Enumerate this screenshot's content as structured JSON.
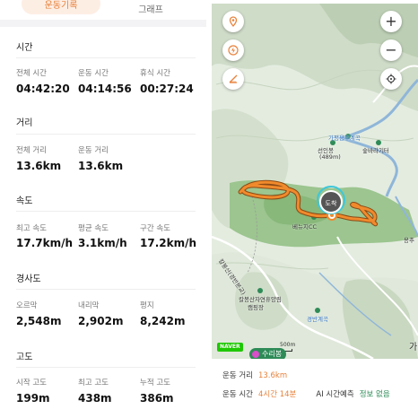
{
  "tabs": {
    "active": "운동기록",
    "inactive": "그래프"
  },
  "sections": {
    "time": {
      "title": "시간",
      "stats": [
        {
          "label": "전체 시간",
          "value": "04:42:20"
        },
        {
          "label": "운동 시간",
          "value": "04:14:56"
        },
        {
          "label": "휴식 시간",
          "value": "00:27:24"
        }
      ]
    },
    "distance": {
      "title": "거리",
      "stats": [
        {
          "label": "전체 거리",
          "value": "13.6km"
        },
        {
          "label": "운동 거리",
          "value": "13.6km"
        }
      ]
    },
    "speed": {
      "title": "속도",
      "stats": [
        {
          "label": "최고 속도",
          "value": "17.7km/h"
        },
        {
          "label": "평균 속도",
          "value": "3.1km/h"
        },
        {
          "label": "구간 속도",
          "value": "17.2km/h"
        }
      ]
    },
    "slope": {
      "title": "경사도",
      "stats": [
        {
          "label": "오르막",
          "value": "2,548m"
        },
        {
          "label": "내리막",
          "value": "2,902m"
        },
        {
          "label": "평지",
          "value": "8,242m"
        }
      ]
    },
    "altitude": {
      "title": "고도",
      "stats": [
        {
          "label": "시작 고도",
          "value": "199m"
        },
        {
          "label": "최고 고도",
          "value": "438m"
        },
        {
          "label": "누적 고도",
          "value": "386m"
        }
      ]
    }
  },
  "map": {
    "places": {
      "valley1": "가평용추계곡",
      "peak_name": "선인봉",
      "peak_height": "(489m)",
      "forest": "숲바라기터",
      "cc": "베뉴지CC",
      "camp_line1": "칼봉산자연휴양림",
      "camp_line2": "캠핑장",
      "valley2": "경반계곡",
      "road": "칼봉산(경반분교)",
      "edge1": "용추",
      "edge2": "가"
    },
    "arrival_marker": "도착",
    "brand": "NAVER",
    "scale": "500m",
    "poi_chip": "수리봉",
    "route_color": "#f08a2c",
    "icons": [
      "pin-icon",
      "lightning-icon",
      "ruler-icon",
      "plus-icon",
      "minus-icon",
      "locate-icon"
    ]
  },
  "info": {
    "exercise_distance_label": "운동 거리",
    "exercise_distance_value": "13.6km",
    "exercise_time_label": "운동 시간",
    "exercise_time_value": "4시간 14분",
    "ai_label": "AI 시간예측",
    "ai_value": "정보 없음"
  },
  "colors": {
    "accent": "#e8823b",
    "positive": "#2e8b57"
  }
}
